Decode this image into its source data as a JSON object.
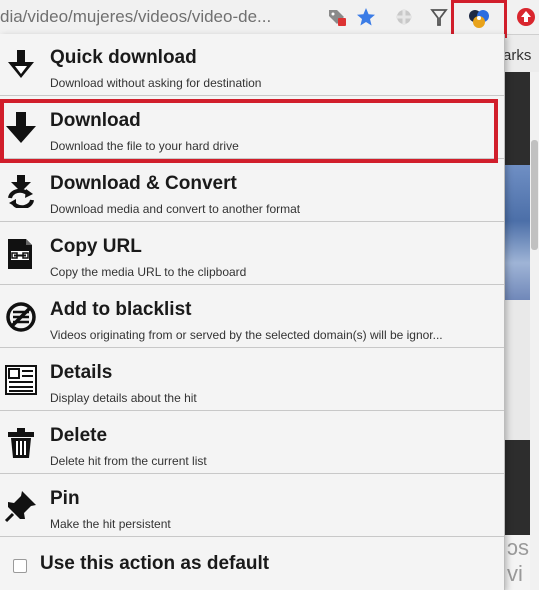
{
  "toolbar": {
    "url": "dia/video/mujeres/videos/video-de...",
    "icons": [
      "tag-icon",
      "star-icon",
      "extension-icon",
      "funnel-icon",
      "video-downloader-icon",
      "close-circle-icon"
    ],
    "accent_color": "#d11e2b"
  },
  "page": {
    "bookmarks_label": "arks",
    "bottom_text": "ɔs\nvi"
  },
  "menu": {
    "items": [
      {
        "title": "Quick download",
        "desc": "Download without asking for destination",
        "icon": "quick-download-icon"
      },
      {
        "title": "Download",
        "desc": "Download the file to your hard drive",
        "icon": "download-arrow-icon"
      },
      {
        "title": "Download & Convert",
        "desc": "Download media and convert to another format",
        "icon": "download-convert-icon"
      },
      {
        "title": "Copy URL",
        "desc": "Copy the media URL to the clipboard",
        "icon": "copy-url-icon"
      },
      {
        "title": "Add to blacklist",
        "desc": "Videos originating from or served by the selected domain(s) will be ignor...",
        "icon": "blacklist-icon"
      },
      {
        "title": "Details",
        "desc": "Display details about the hit",
        "icon": "details-icon"
      },
      {
        "title": "Delete",
        "desc": "Delete hit from the current list",
        "icon": "trash-icon"
      },
      {
        "title": "Pin",
        "desc": "Make the hit persistent",
        "icon": "pin-icon"
      }
    ],
    "default_label": "Use this action as default",
    "default_checked": false
  }
}
